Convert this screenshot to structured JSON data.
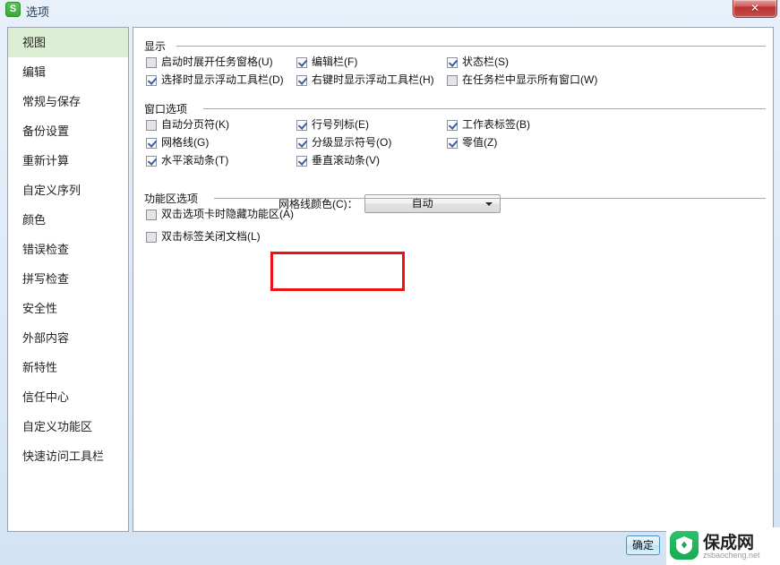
{
  "window": {
    "title": "选项",
    "icon_name": "wps-spreadsheet-icon",
    "icon_letter": "S",
    "close_glyph": "✕"
  },
  "sidebar": {
    "items": [
      {
        "label": "视图",
        "selected": true
      },
      {
        "label": "编辑",
        "selected": false
      },
      {
        "label": "常规与保存",
        "selected": false
      },
      {
        "label": "备份设置",
        "selected": false
      },
      {
        "label": "重新计算",
        "selected": false
      },
      {
        "label": "自定义序列",
        "selected": false
      },
      {
        "label": "颜色",
        "selected": false
      },
      {
        "label": "错误检查",
        "selected": false
      },
      {
        "label": "拼写检查",
        "selected": false
      },
      {
        "label": "安全性",
        "selected": false
      },
      {
        "label": "外部内容",
        "selected": false
      },
      {
        "label": "新特性",
        "selected": false
      },
      {
        "label": "信任中心",
        "selected": false
      },
      {
        "label": "自定义功能区",
        "selected": false
      },
      {
        "label": "快速访问工具栏",
        "selected": false
      }
    ]
  },
  "groups": {
    "display": {
      "label": "显示",
      "checkboxes": [
        {
          "label": "启动时展开任务窗格(U)",
          "checked": false,
          "col": 0,
          "row": 0
        },
        {
          "label": "选择时显示浮动工具栏(D)",
          "checked": true,
          "col": 0,
          "row": 1
        },
        {
          "label": "编辑栏(F)",
          "checked": true,
          "col": 1,
          "row": 0
        },
        {
          "label": "右键时显示浮动工具栏(H)",
          "checked": true,
          "col": 1,
          "row": 1
        },
        {
          "label": "状态栏(S)",
          "checked": true,
          "col": 2,
          "row": 0
        },
        {
          "label": "在任务栏中显示所有窗口(W)",
          "checked": false,
          "col": 2,
          "row": 1
        }
      ]
    },
    "window_options": {
      "label": "窗口选项",
      "checkboxes": [
        {
          "label": "自动分页符(K)",
          "checked": false,
          "col": 0,
          "row": 0
        },
        {
          "label": "网格线(G)",
          "checked": true,
          "col": 0,
          "row": 1
        },
        {
          "label": "水平滚动条(T)",
          "checked": true,
          "col": 0,
          "row": 2
        },
        {
          "label": "行号列标(E)",
          "checked": true,
          "col": 1,
          "row": 0
        },
        {
          "label": "分级显示符号(O)",
          "checked": true,
          "col": 1,
          "row": 1
        },
        {
          "label": "垂直滚动条(V)",
          "checked": true,
          "col": 1,
          "row": 2
        },
        {
          "label": "工作表标签(B)",
          "checked": true,
          "col": 2,
          "row": 0
        },
        {
          "label": "零值(Z)",
          "checked": true,
          "col": 2,
          "row": 1
        }
      ],
      "gridline_color": {
        "label": "网格线颜色(C)：",
        "value": "自动"
      }
    },
    "ribbon_options": {
      "label": "功能区选项",
      "checkboxes": [
        {
          "label": "双击选项卡时隐藏功能区(A)",
          "checked": false,
          "row": 0
        },
        {
          "label": "双击标签关闭文档(L)",
          "checked": false,
          "row": 1
        }
      ]
    }
  },
  "footer": {
    "button_label": "确定"
  },
  "watermark": {
    "name": "保成网",
    "url": "zsbaocheng.net",
    "color": "#17ab52"
  }
}
